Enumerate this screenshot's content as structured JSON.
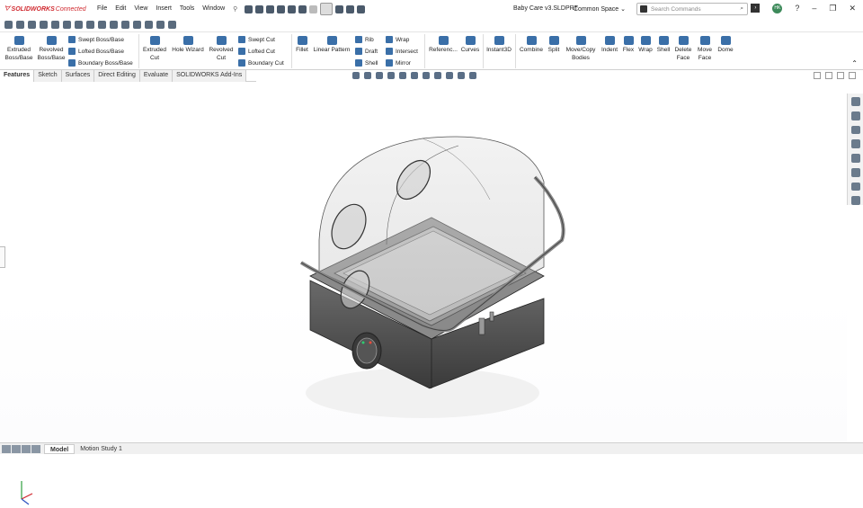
{
  "app": {
    "brand": "SOLIDWORKS",
    "brand_suffix": "Connected",
    "document_title": "Baby Care v3.SLDPRT",
    "workspace": "Common Space"
  },
  "menu": [
    "File",
    "Edit",
    "View",
    "Insert",
    "Tools",
    "Window"
  ],
  "search": {
    "placeholder": "Search Commands"
  },
  "user_initials": "HK",
  "ribbon": {
    "extruded_boss": "Extruded Boss/Base",
    "revolved_boss": "Revolved Boss/Base",
    "swept_boss": "Swept Boss/Base",
    "lofted_boss": "Lofted Boss/Base",
    "boundary_boss": "Boundary Boss/Base",
    "extruded_cut": "Extruded Cut",
    "hole_wizard": "Hole Wizard",
    "revolved_cut": "Revolved Cut",
    "swept_cut": "Swept Cut",
    "lofted_cut": "Lofted Cut",
    "boundary_cut": "Boundary Cut",
    "fillet": "Fillet",
    "linear_pattern": "Linear Pattern",
    "rib": "Rib",
    "draft": "Draft",
    "shell": "Shell",
    "wrap": "Wrap",
    "intersect": "Intersect",
    "mirror": "Mirror",
    "reference": "Referenc...",
    "curves": "Curves",
    "instant3d": "Instant3D",
    "combine": "Combine",
    "split": "Split",
    "move_copy": "Move/Copy Bodies",
    "indent": "Indent",
    "flex": "Flex",
    "wrap2": "Wrap",
    "shell2": "Shell",
    "delete_face": "Delete Face",
    "move_face": "Move Face",
    "dome": "Dome"
  },
  "tabs": [
    "Features",
    "Sketch",
    "Surfaces",
    "Direct Editing",
    "Evaluate",
    "SOLIDWORKS Add-Ins"
  ],
  "bottom_tabs": [
    "Model",
    "Motion Study 1"
  ],
  "colors": {
    "accent": "#3a6fa8",
    "brand": "#d0282e"
  }
}
